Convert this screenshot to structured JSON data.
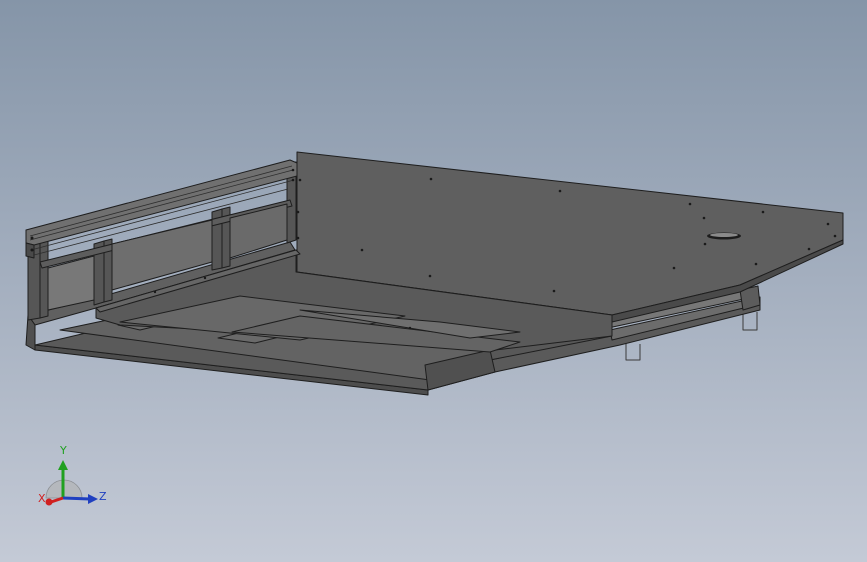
{
  "viewport": {
    "background_top": "#8595a8",
    "background_bottom": "#c4cad6"
  },
  "model": {
    "body_color": "#5f5f5f",
    "edge_color": "#1e1e1e"
  },
  "triad": {
    "x_label": "X",
    "y_label": "Y",
    "z_label": "Z",
    "x_color": "#d02020",
    "y_color": "#20a020",
    "z_color": "#2040c0"
  }
}
